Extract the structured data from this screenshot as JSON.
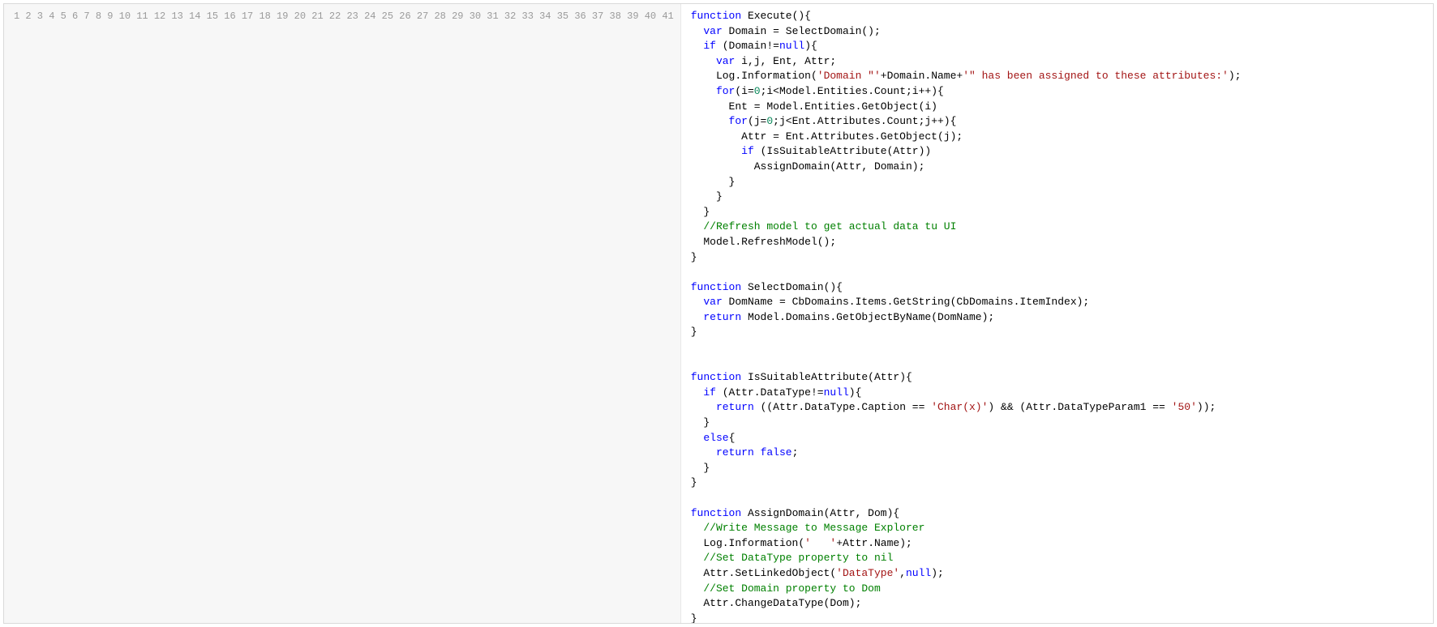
{
  "editor": {
    "lineCount": 41,
    "tokens": [
      [
        [
          "kw",
          "function"
        ],
        [
          "fn",
          " Execute(){"
        ]
      ],
      [
        [
          "fn",
          "  "
        ],
        [
          "kw",
          "var"
        ],
        [
          "fn",
          " Domain = SelectDomain();"
        ]
      ],
      [
        [
          "fn",
          "  "
        ],
        [
          "kw",
          "if"
        ],
        [
          "fn",
          " (Domain!="
        ],
        [
          "lit",
          "null"
        ],
        [
          "fn",
          "){"
        ]
      ],
      [
        [
          "fn",
          "    "
        ],
        [
          "kw",
          "var"
        ],
        [
          "fn",
          " i,j, Ent, Attr;"
        ]
      ],
      [
        [
          "fn",
          "    Log.Information("
        ],
        [
          "str",
          "'Domain \"'"
        ],
        [
          "fn",
          "+Domain.Name+"
        ],
        [
          "str",
          "'\" has been assigned to these attributes:'"
        ],
        [
          "fn",
          ");"
        ]
      ],
      [
        [
          "fn",
          "    "
        ],
        [
          "kw",
          "for"
        ],
        [
          "fn",
          "(i="
        ],
        [
          "num",
          "0"
        ],
        [
          "fn",
          ";i<Model.Entities.Count;i++){"
        ]
      ],
      [
        [
          "fn",
          "      Ent = Model.Entities.GetObject(i)"
        ]
      ],
      [
        [
          "fn",
          "      "
        ],
        [
          "kw",
          "for"
        ],
        [
          "fn",
          "(j="
        ],
        [
          "num",
          "0"
        ],
        [
          "fn",
          ";j<Ent.Attributes.Count;j++){"
        ]
      ],
      [
        [
          "fn",
          "        Attr = Ent.Attributes.GetObject(j);"
        ]
      ],
      [
        [
          "fn",
          "        "
        ],
        [
          "kw",
          "if"
        ],
        [
          "fn",
          " (IsSuitableAttribute(Attr))"
        ]
      ],
      [
        [
          "fn",
          "          AssignDomain(Attr, Domain);"
        ]
      ],
      [
        [
          "fn",
          "      }"
        ]
      ],
      [
        [
          "fn",
          "    }"
        ]
      ],
      [
        [
          "fn",
          "  }"
        ]
      ],
      [
        [
          "fn",
          "  "
        ],
        [
          "cm",
          "//Refresh model to get actual data tu UI"
        ]
      ],
      [
        [
          "fn",
          "  Model.RefreshModel();"
        ]
      ],
      [
        [
          "fn",
          "}"
        ]
      ],
      [
        [
          "fn",
          ""
        ]
      ],
      [
        [
          "kw",
          "function"
        ],
        [
          "fn",
          " SelectDomain(){"
        ]
      ],
      [
        [
          "fn",
          "  "
        ],
        [
          "kw",
          "var"
        ],
        [
          "fn",
          " DomName = CbDomains.Items.GetString(CbDomains.ItemIndex);"
        ]
      ],
      [
        [
          "fn",
          "  "
        ],
        [
          "kw",
          "return"
        ],
        [
          "fn",
          " Model.Domains.GetObjectByName(DomName);"
        ]
      ],
      [
        [
          "fn",
          "}"
        ]
      ],
      [
        [
          "fn",
          ""
        ]
      ],
      [
        [
          "fn",
          ""
        ]
      ],
      [
        [
          "kw",
          "function"
        ],
        [
          "fn",
          " IsSuitableAttribute(Attr){"
        ]
      ],
      [
        [
          "fn",
          "  "
        ],
        [
          "kw",
          "if"
        ],
        [
          "fn",
          " (Attr.DataType!="
        ],
        [
          "lit",
          "null"
        ],
        [
          "fn",
          "){"
        ]
      ],
      [
        [
          "fn",
          "    "
        ],
        [
          "kw",
          "return"
        ],
        [
          "fn",
          " ((Attr.DataType.Caption == "
        ],
        [
          "str",
          "'Char(x)'"
        ],
        [
          "fn",
          ") && (Attr.DataTypeParam1 == "
        ],
        [
          "str",
          "'50'"
        ],
        [
          "fn",
          "));"
        ]
      ],
      [
        [
          "fn",
          "  }"
        ]
      ],
      [
        [
          "fn",
          "  "
        ],
        [
          "kw",
          "else"
        ],
        [
          "fn",
          "{"
        ]
      ],
      [
        [
          "fn",
          "    "
        ],
        [
          "kw",
          "return"
        ],
        [
          "fn",
          " "
        ],
        [
          "lit",
          "false"
        ],
        [
          "fn",
          ";"
        ]
      ],
      [
        [
          "fn",
          "  }"
        ]
      ],
      [
        [
          "fn",
          "}"
        ]
      ],
      [
        [
          "fn",
          ""
        ]
      ],
      [
        [
          "kw",
          "function"
        ],
        [
          "fn",
          " AssignDomain(Attr, Dom){"
        ]
      ],
      [
        [
          "fn",
          "  "
        ],
        [
          "cm",
          "//Write Message to Message Explorer"
        ]
      ],
      [
        [
          "fn",
          "  Log.Information("
        ],
        [
          "str",
          "'   '"
        ],
        [
          "fn",
          "+Attr.Name);"
        ]
      ],
      [
        [
          "fn",
          "  "
        ],
        [
          "cm",
          "//Set DataType property to nil"
        ]
      ],
      [
        [
          "fn",
          "  Attr.SetLinkedObject("
        ],
        [
          "str",
          "'DataType'"
        ],
        [
          "fn",
          ","
        ],
        [
          "lit",
          "null"
        ],
        [
          "fn",
          ");"
        ]
      ],
      [
        [
          "fn",
          "  "
        ],
        [
          "cm",
          "//Set Domain property to Dom"
        ]
      ],
      [
        [
          "fn",
          "  Attr.ChangeDataType(Dom);"
        ]
      ],
      [
        [
          "fn",
          "}"
        ]
      ]
    ]
  }
}
